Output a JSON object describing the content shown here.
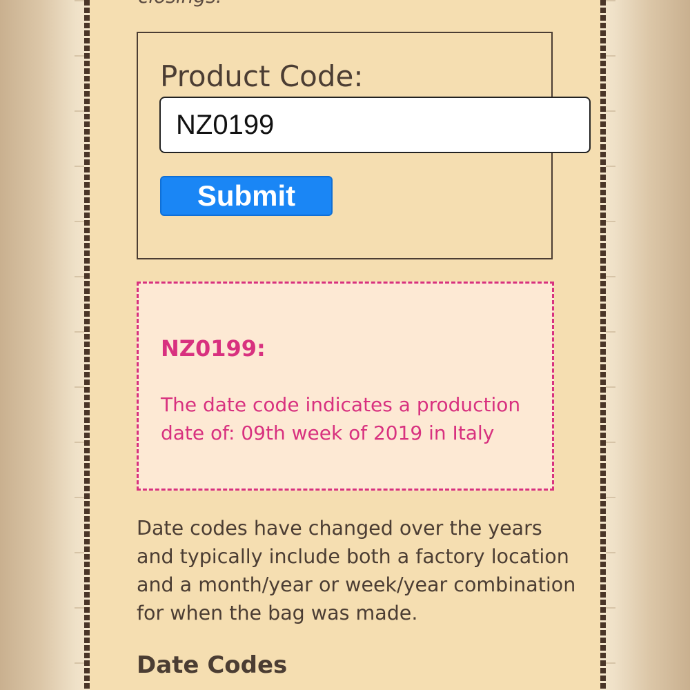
{
  "top_snippet": "closings.",
  "form": {
    "label": "Product Code:",
    "input_value": "NZ0199",
    "submit_label": "Submit"
  },
  "result": {
    "code": "NZ0199:",
    "message": "The date code indicates a production date of: 09th week of 2019 in Italy"
  },
  "info": {
    "paragraph": "Date codes have changed over the years and typically include both a factory location and a month/year or week/year combination for when the bag was made.",
    "heading": "Date Codes"
  },
  "colors": {
    "panel_background": "#f5deb1",
    "accent_magenta": "#d8317f",
    "button_blue": "#1a86f5",
    "text_brown": "#4b3d33"
  }
}
